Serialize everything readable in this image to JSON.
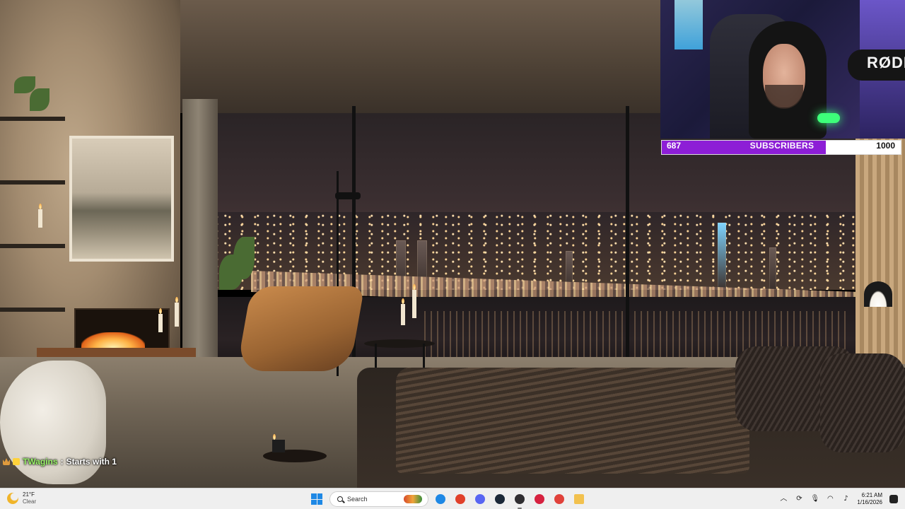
{
  "stream": {
    "subscriber_goal": {
      "current": "687",
      "label": "SUBSCRIBERS",
      "target": "1000",
      "progress": 0.687,
      "fill_color": "#8d1ed6"
    },
    "webcam": {
      "mic_brand": "RØDE"
    },
    "chat": {
      "badges": [
        "crown-badge",
        "subscriber-badge"
      ],
      "username": "TWagins",
      "separator": ":",
      "message": "Starts with 1",
      "username_color": "#9bf56a"
    }
  },
  "taskbar": {
    "weather": {
      "temperature": "21°F",
      "condition": "Clear",
      "icon": "moon-icon"
    },
    "search_placeholder": "Search",
    "apps": [
      {
        "name": "edge-icon",
        "color": "#1e88e5"
      },
      {
        "name": "chrome-icon",
        "color": "#e0402a"
      },
      {
        "name": "discord-icon",
        "color": "#5865f2"
      },
      {
        "name": "steam-icon",
        "color": "#1b2838"
      },
      {
        "name": "obs-icon",
        "color": "#302e31"
      },
      {
        "name": "opera-icon",
        "color": "#d6213f"
      },
      {
        "name": "red-app-icon",
        "color": "#e0413a"
      },
      {
        "name": "file-explorer-icon",
        "color": "#f2c14e"
      }
    ],
    "tray": {
      "icons": [
        "chevron-up-icon",
        "share-icon",
        "mic-icon",
        "wifi-icon",
        "volume-icon"
      ],
      "time": "6:21 AM",
      "date": "1/16/2026"
    }
  }
}
